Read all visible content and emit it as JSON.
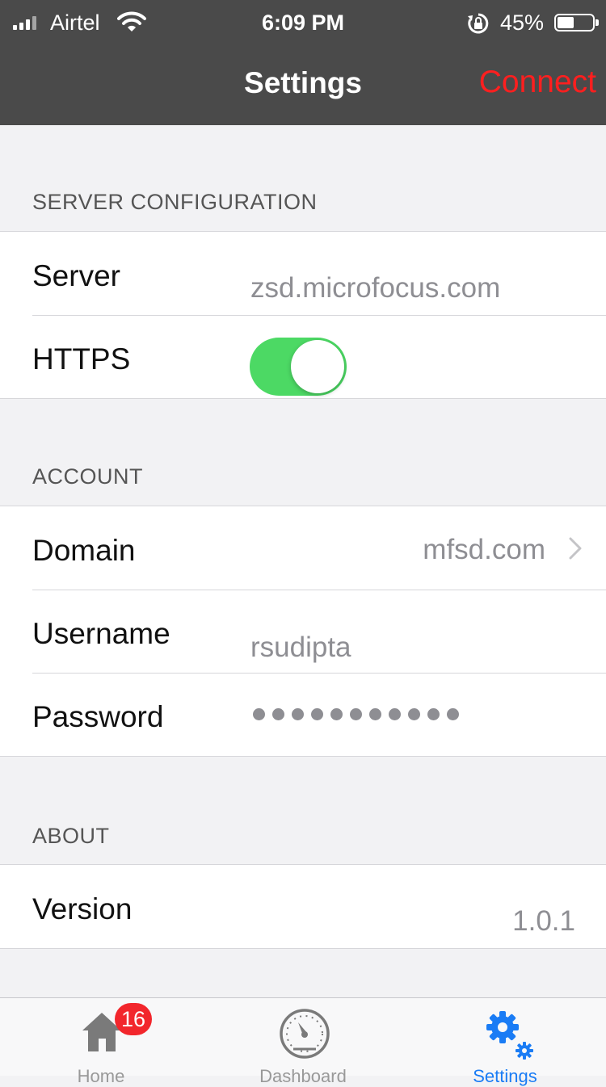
{
  "status_bar": {
    "carrier": "Airtel",
    "time": "6:09 PM",
    "battery_percent": "45%",
    "battery_level": 0.45,
    "icons": [
      "signal-icon",
      "wifi-icon",
      "rotation-lock-icon",
      "battery-icon"
    ]
  },
  "nav": {
    "title": "Settings",
    "connect_label": "Connect",
    "connect_color": "#ff1f1f"
  },
  "sections": {
    "server": {
      "header": "SERVER CONFIGURATION",
      "server_label": "Server",
      "server_value": "zsd.microfocus.com",
      "https_label": "HTTPS",
      "https_on": true
    },
    "account": {
      "header": "ACCOUNT",
      "domain_label": "Domain",
      "domain_value": "mfsd.com",
      "username_label": "Username",
      "username_value": "rsudipta",
      "password_label": "Password",
      "password_masked_length": 11
    },
    "about": {
      "header": "ABOUT",
      "version_label": "Version",
      "version_value": "1.0.1"
    }
  },
  "tabbar": {
    "tabs": [
      {
        "label": "Home",
        "icon": "home-icon",
        "badge": "16"
      },
      {
        "label": "Dashboard",
        "icon": "dashboard-icon"
      },
      {
        "label": "Settings",
        "icon": "settings-icon",
        "active": true
      }
    ],
    "active_color": "#1a7cf5",
    "badge_color": "#f2262c"
  },
  "colors": {
    "nav_background": "#4a4a4a",
    "toggle_on": "#4cd964"
  }
}
